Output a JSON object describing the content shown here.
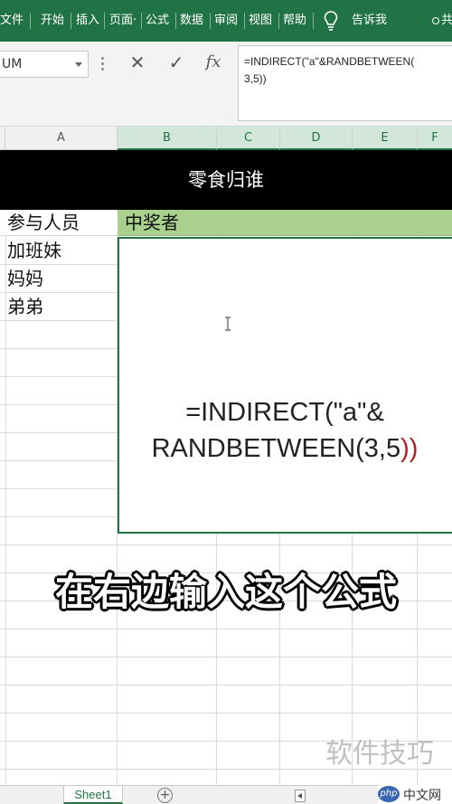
{
  "ribbon": {
    "tabs": [
      "文件",
      "开始",
      "插入",
      "页面·",
      "公式",
      "数据",
      "审阅",
      "视图",
      "帮助"
    ],
    "tell_me": "告诉我",
    "share": "共"
  },
  "formula_bar": {
    "name_box": "UM",
    "cancel_symbol": "✕",
    "enter_symbol": "✓",
    "fx_symbol": "fx",
    "line1": "=INDIRECT(\"a\"&RANDBETWEEN(",
    "line2": "3,5))"
  },
  "columns": [
    "A",
    "B",
    "C",
    "D",
    "E",
    "F"
  ],
  "sheet": {
    "banner": "零食归谁",
    "header_a": "参与人员",
    "header_b": "中奖者",
    "names": [
      "加班妹",
      "妈妈",
      "弟弟"
    ],
    "formula_line1": "=INDIRECT(\"a\"&",
    "formula_line2_text": "RANDBETWEEN(3,5",
    "formula_line2_paren": "))"
  },
  "caption": "在右边输入这个公式",
  "watermark": "软件技巧",
  "tabs_bar": {
    "sheet_name": "Sheet1",
    "add_symbol": "+"
  },
  "logo": {
    "mark": "php",
    "text": "中文网"
  },
  "colors": {
    "excel_green": "#217346",
    "header_highlight": "#a9d08e",
    "banner_bg": "#000000"
  }
}
